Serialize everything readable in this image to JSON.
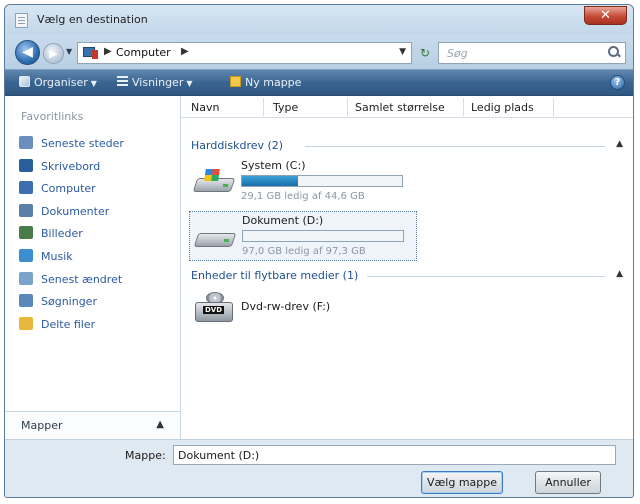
{
  "window": {
    "title": "Vælg en destination"
  },
  "address_bar": {
    "breadcrumb": [
      "Computer"
    ],
    "search_placeholder": "Søg"
  },
  "toolbar": {
    "organize_label": "Organiser",
    "views_label": "Visninger",
    "new_folder_label": "Ny mappe"
  },
  "nav_pane": {
    "header": "Favoritlinks",
    "items": [
      {
        "label": "Seneste steder",
        "icon": "recent-places-icon",
        "color": "#6a8fbf"
      },
      {
        "label": "Skrivebord",
        "icon": "desktop-icon",
        "color": "#2a5f9e"
      },
      {
        "label": "Computer",
        "icon": "computer-icon",
        "color": "#3c6fb0"
      },
      {
        "label": "Dokumenter",
        "icon": "documents-icon",
        "color": "#5b7fa6"
      },
      {
        "label": "Billeder",
        "icon": "pictures-icon",
        "color": "#4a7c4a"
      },
      {
        "label": "Musik",
        "icon": "music-icon",
        "color": "#3b8fd1"
      },
      {
        "label": "Senest ændret",
        "icon": "recently-changed-icon",
        "color": "#7aa3cc"
      },
      {
        "label": "Søgninger",
        "icon": "searches-icon",
        "color": "#5a88b8"
      },
      {
        "label": "Delte filer",
        "icon": "shared-folder-icon",
        "color": "#e6b73a"
      }
    ],
    "folders_label": "Mapper"
  },
  "columns": [
    "Navn",
    "Type",
    "Samlet størrelse",
    "Ledig plads"
  ],
  "groups": [
    {
      "title": "Harddiskdrev (2)",
      "drives": [
        {
          "name": "System (C:)",
          "free_text": "29,1 GB ledig af 44,6 GB",
          "used_fraction": 0.35,
          "selected": false
        },
        {
          "name": "Dokument (D:)",
          "free_text": "97,0 GB ledig af 97,3 GB",
          "used_fraction": 0.003,
          "selected": true
        }
      ]
    },
    {
      "title": "Enheder til flytbare medier (1)",
      "devices": [
        {
          "name": "Dvd-rw-drev (F:)",
          "badge": "DVD"
        }
      ]
    }
  ],
  "footer": {
    "folder_label": "Mappe:",
    "folder_value": "Dokument (D:)",
    "select_button": "Vælg mappe",
    "cancel_button": "Annuller"
  }
}
